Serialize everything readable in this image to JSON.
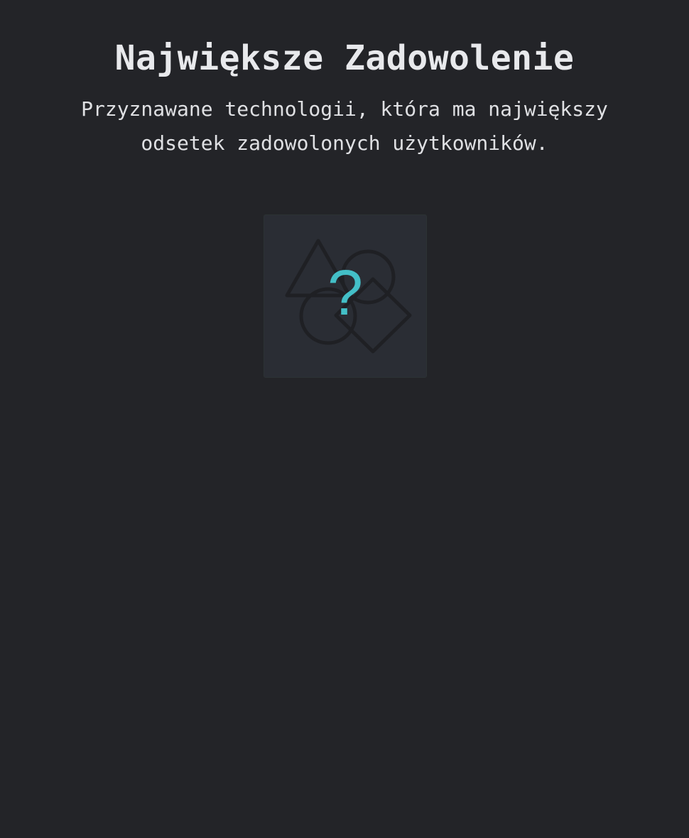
{
  "header": {
    "title": "Największe Zadowolenie",
    "description": "Przyznawane technologii, która ma największy odsetek zadowolonych użytkowników."
  },
  "award": {
    "icon": "unknown-technology-icon",
    "glyph": "?",
    "accent_color": "#43bfc7",
    "shape_color": "#1f2024"
  }
}
